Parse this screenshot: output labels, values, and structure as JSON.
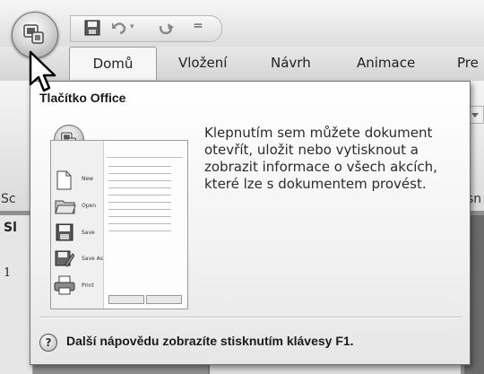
{
  "tabs": [
    {
      "label": "Domů"
    },
    {
      "label": "Vložení"
    },
    {
      "label": "Návrh"
    },
    {
      "label": "Animace"
    },
    {
      "label": "Pre"
    }
  ],
  "quick_access": {
    "separator": "="
  },
  "side": {
    "ribbon_left_fragment": "Sc",
    "ribbon_right_fragment": "sn",
    "panel_label": "Sl",
    "slide_number": "1"
  },
  "tooltip": {
    "title": "Tlačítko Office",
    "body": "Klepnutím sem můžete dokument otevřít, uložit nebo vytisknout a zobrazit informace o všech akcích, které lze s dokumentem provést.",
    "footer": "Další nápovědu zobrazíte stisknutím klávesy F1.",
    "help_icon": "question-mark-icon"
  },
  "thumbnail": {
    "menu": [
      {
        "label": "New"
      },
      {
        "label": "Open"
      },
      {
        "label": "Save"
      },
      {
        "label": "Save As"
      },
      {
        "label": "Print"
      }
    ]
  },
  "colors": {
    "tooltip_border": "#707070",
    "ribbon": "#e4e4e4",
    "background": "#9a9a9a"
  }
}
